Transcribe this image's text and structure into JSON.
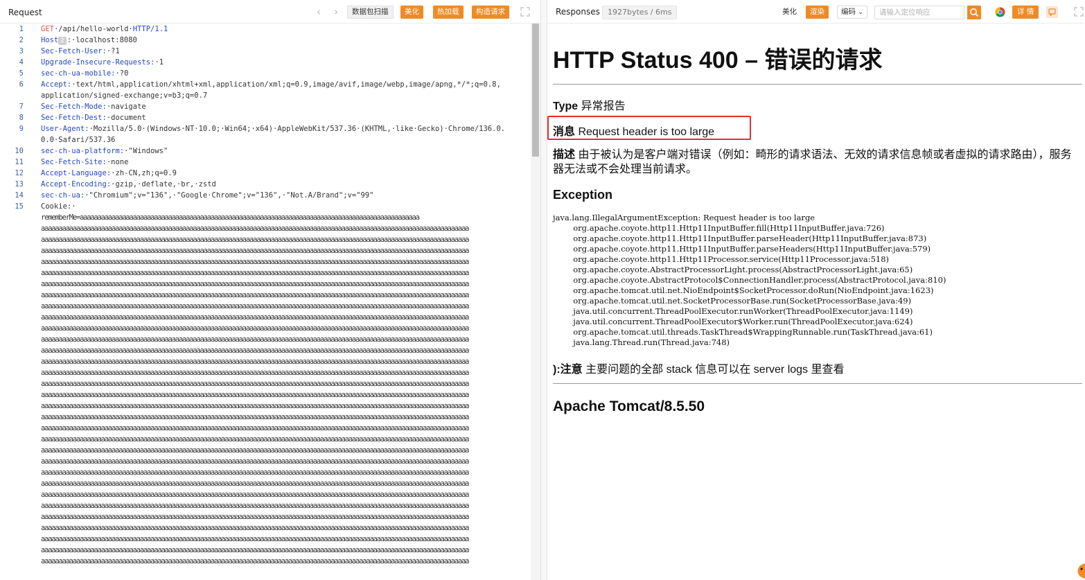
{
  "request": {
    "title": "Request",
    "buttons": {
      "scan": "数据包扫描",
      "beautify": "美化",
      "hot_load": "热加载",
      "build": "构造请求"
    },
    "line_numbers": [
      "1",
      "2",
      "3",
      "4",
      "5",
      "6",
      "7",
      "8",
      "9",
      "10",
      "11",
      "12",
      "13",
      "14",
      "15"
    ],
    "lines": {
      "l1_method": "GET",
      "l1_path": "·/api/hello-world·",
      "l1_proto": "HTTP/1.1",
      "l2_key": "Host",
      "l2_badge": "2",
      "l2_val": ":·localhost:8080",
      "l3_key": "Sec-Fetch-User:",
      "l3_val": "·?1",
      "l4_key": "Upgrade-Insecure-Requests:",
      "l4_val": "·1",
      "l5_key": "sec-ch-ua-mobile:",
      "l5_val": "·?0",
      "l6_key": "Accept:",
      "l6_val": "·text/html,application/xhtml+xml,application/xml;q=0.9,image/avif,image/webp,image/apng,*/*;q=0.8,",
      "l6_cont": "application/signed-exchange;v=b3;q=0.7",
      "l7_key": "Sec-Fetch-Mode:",
      "l7_val": "·navigate",
      "l8_key": "Sec-Fetch-Dest:",
      "l8_val": "·document",
      "l9_key": "User-Agent:",
      "l9_val": "·Mozilla/5.0·(Windows·NT·10.0;·Win64;·x64)·AppleWebKit/537.36·(KHTML,·like·Gecko)·Chrome/136.0.",
      "l9_cont": "0.0·Safari/537.36",
      "l10_key": "sec-ch-ua-platform:",
      "l10_val": "·\"Windows\"",
      "l11_key": "Sec-Fetch-Site:",
      "l11_val": "·none",
      "l12_key": "Accept-Language:",
      "l12_val": "·zh-CN,zh;q=0.9",
      "l13_key": "Accept-Encoding:",
      "l13_val": "·gzip,·deflate,·br,·zstd",
      "l14_key": "sec-ch-ua:",
      "l14_val": "·\"Chromium\";v=\"136\",·\"Google·Chrome\";v=\"136\",·\"Not.A/Brand\";v=\"99\"",
      "l15": "Cookie:·",
      "cookie_start": "rememberMe=aaaaaaaaaaaaaaaaaaaaaaaaaaaaaaaaaaaaaaaaaaaaaaaaaaaaaaaaaaaaaaaaaaaaaaaaaaaaaaaaaaaaaaaaaaaaaaaa",
      "cookie_fill": "aaaaaaaaaaaaaaaaaaaaaaaaaaaaaaaaaaaaaaaaaaaaaaaaaaaaaaaaaaaaaaaaaaaaaaaaaaaaaaaaaaaaaaaaaaaaaaaaaaaaaaaaaaaaaaaaaaaaaaaaa"
    }
  },
  "response": {
    "title": "Responses",
    "size": "1927bytes / 6ms",
    "buttons": {
      "beautify": "美化",
      "render": "渲染",
      "encoding": "编码",
      "details": "详 情"
    },
    "search_placeholder": "请输入定位响应",
    "heading": "HTTP Status 400 – 错误的请求",
    "type_label": "Type",
    "type_value": "异常报告",
    "message_label": "消息",
    "message_value": "Request header is too large",
    "desc_label": "描述",
    "desc_value": "由于被认为是客户端对错误（例如：畸形的请求语法、无效的请求信息帧或者虚拟的请求路由），服务器无法或不会处理当前请求。",
    "exception_label": "Exception",
    "stack_trace": "java.lang.IllegalArgumentException: Request header is too large\n\torg.apache.coyote.http11.Http11InputBuffer.fill(Http11InputBuffer.java:726)\n\torg.apache.coyote.http11.Http11InputBuffer.parseHeader(Http11InputBuffer.java:873)\n\torg.apache.coyote.http11.Http11InputBuffer.parseHeaders(Http11InputBuffer.java:579)\n\torg.apache.coyote.http11.Http11Processor.service(Http11Processor.java:518)\n\torg.apache.coyote.AbstractProcessorLight.process(AbstractProcessorLight.java:65)\n\torg.apache.coyote.AbstractProtocol$ConnectionHandler.process(AbstractProtocol.java:810)\n\torg.apache.tomcat.util.net.NioEndpoint$SocketProcessor.doRun(NioEndpoint.java:1623)\n\torg.apache.tomcat.util.net.SocketProcessorBase.run(SocketProcessorBase.java:49)\n\tjava.util.concurrent.ThreadPoolExecutor.runWorker(ThreadPoolExecutor.java:1149)\n\tjava.util.concurrent.ThreadPoolExecutor$Worker.run(ThreadPoolExecutor.java:624)\n\torg.apache.tomcat.util.threads.TaskThread$WrappingRunnable.run(TaskThread.java:61)\n\tjava.lang.Thread.run(Thread.java:748)",
    "note_label": "):注意",
    "note_value": "主要问题的全部 stack 信息可以在 server logs 里查看",
    "footer": "Apache Tomcat/8.5.50"
  },
  "colors": {
    "accent": "#f08a24",
    "highlight_border": "#e0302b",
    "header_key": "#2447c4",
    "method": "#d9534f"
  }
}
